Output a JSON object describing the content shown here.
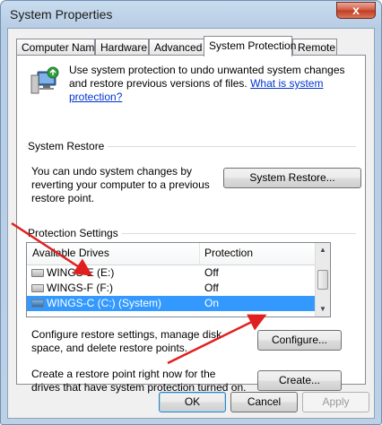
{
  "window": {
    "title": "System Properties",
    "close_glyph": "x"
  },
  "tabs": [
    {
      "label": "Computer Name"
    },
    {
      "label": "Hardware"
    },
    {
      "label": "Advanced"
    },
    {
      "label": "System Protection",
      "active": true
    },
    {
      "label": "Remote"
    }
  ],
  "intro": {
    "text": "Use system protection to undo unwanted system changes and restore previous versions of files.",
    "link": "What is system protection?"
  },
  "system_restore": {
    "section_title": "System Restore",
    "description": "You can undo system changes by reverting your computer to a previous restore point.",
    "button_label": "System Restore..."
  },
  "protection": {
    "section_title": "Protection Settings",
    "columns": [
      "Available Drives",
      "Protection"
    ],
    "drives": [
      {
        "name": "WINGS-E (E:)",
        "protection": "Off",
        "selected": false
      },
      {
        "name": "WINGS-F (F:)",
        "protection": "Off",
        "selected": false
      },
      {
        "name": "WINGS-C (C:) (System)",
        "protection": "On",
        "selected": true
      }
    ],
    "configure_text": "Configure restore settings, manage disk space, and delete restore points.",
    "configure_button": "Configure...",
    "create_text": "Create a restore point right now for the drives that have system protection turned on.",
    "create_button": "Create..."
  },
  "footer": {
    "ok": "OK",
    "cancel": "Cancel",
    "apply": "Apply"
  },
  "colors": {
    "selection": "#3399ff",
    "link": "#0033cc",
    "annotation_arrow": "#e02020"
  }
}
